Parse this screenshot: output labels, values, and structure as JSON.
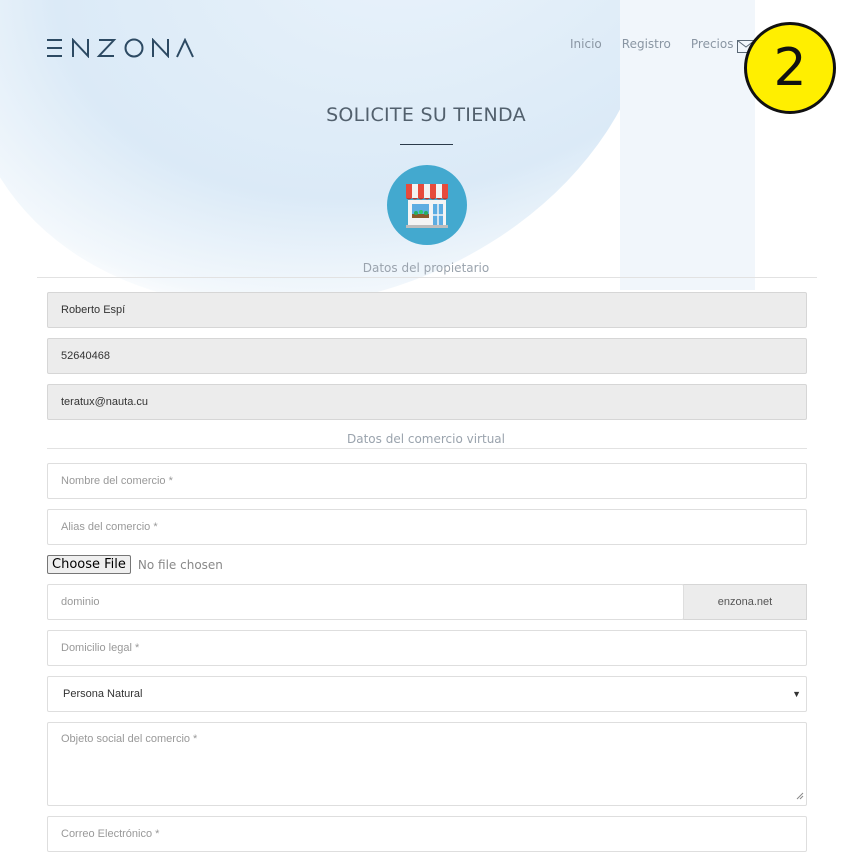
{
  "brand": {
    "logo_text": "ENZONA"
  },
  "nav": {
    "items": [
      {
        "label": "Inicio"
      },
      {
        "label": "Registro"
      },
      {
        "label": "Precios"
      }
    ],
    "icons": [
      "mail-icon"
    ]
  },
  "badge": {
    "text": "2"
  },
  "page": {
    "title": "SOLICITE SU TIENDA",
    "icon": "store-icon"
  },
  "owner_section": {
    "label": "Datos del propietario",
    "name_value": "Roberto Espí",
    "phone_value": "52640468",
    "email_value": "teratux@nauta.cu"
  },
  "shop_section": {
    "label": "Datos del comercio virtual",
    "name_placeholder": "Nombre del comercio *",
    "alias_placeholder": "Alias del comercio *",
    "file_button": "Choose File",
    "file_status": "No file chosen",
    "domain_placeholder": "dominio",
    "domain_suffix": "enzona.net",
    "address_placeholder": "Domicilio legal *",
    "entity_type_value": "Persona Natural",
    "purpose_placeholder": "Objeto social del comercio *",
    "email_placeholder": "Correo Electrónico *"
  },
  "colors": {
    "accent": "#43a9cf",
    "title": "#52606d",
    "badge": "#ffef00"
  }
}
